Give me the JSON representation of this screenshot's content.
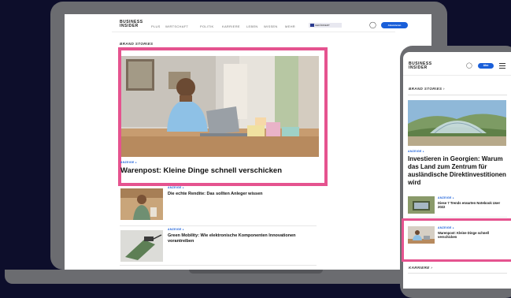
{
  "desktop": {
    "logo": {
      "line1": "BUSINESS",
      "line2": "INSIDER"
    },
    "nav": [
      "PLUS",
      "WIRTSCHAFT",
      "POLITIK",
      "KARRIERE",
      "LEBEN",
      "WISSEN",
      "MEHR"
    ],
    "partner_badge": "GEFÖRDERT",
    "subscribe_label": "Abonnieren",
    "section_label": "BRAND STORIES",
    "featured": {
      "tag": "ANZEIGE",
      "title": "Warenpost: Kleine Dinge schnell verschicken"
    },
    "items": [
      {
        "tag": "ANZEIGE",
        "title": "Die echte Rendite: Das sollten Anleger wissen"
      },
      {
        "tag": "ANZEIGE",
        "title": "Green Mobility: Wie elektronische Komponenten Innovationen vorantreiben"
      }
    ]
  },
  "mobile": {
    "logo": {
      "line1": "BUSINESS",
      "line2": "INSIDER"
    },
    "abo_label": "Abo",
    "section_label": "BRAND STORIES ›",
    "hero": {
      "tag": "ANZEIGE",
      "title": "Investieren in Georgien: Warum das Land zum Zentrum für ausländische Direktinvestitionen wird"
    },
    "items": [
      {
        "tag": "ANZEIGE",
        "title": "Diese 7 Trends erwarten Notebook User 2022"
      },
      {
        "tag": "ANZEIGE",
        "title": "Warenpost: Kleine Dinge schnell verschicken"
      }
    ],
    "next_section": "KARRIERE ›"
  },
  "colors": {
    "background": "#0d0e2b",
    "device_frame": "#6b6c70",
    "highlight": "#e5538f",
    "accent_blue": "#1a5fd9"
  }
}
